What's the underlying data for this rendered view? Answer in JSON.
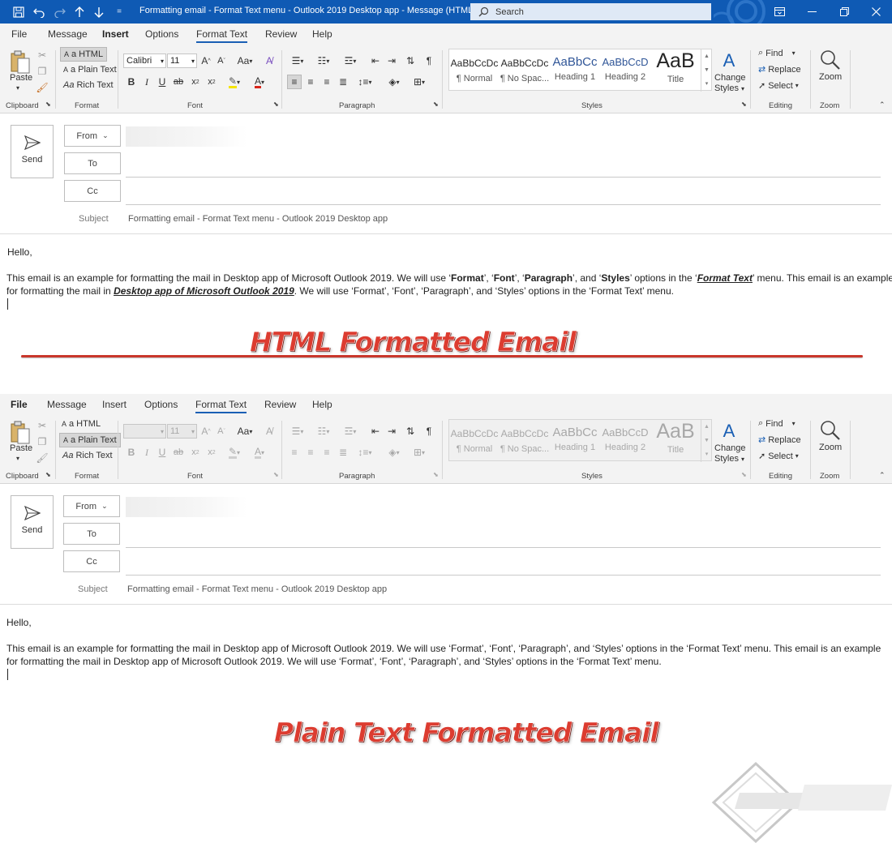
{
  "window": {
    "title": "Formatting email - Format Text menu - Outlook 2019 Desktop app  -  Message (HTML)",
    "search_placeholder": "Search",
    "qa_overflow": "="
  },
  "colors": {
    "titlebar": "#0f5ab4",
    "accent": "#1a5fb4",
    "banner_red": "#dc3c30"
  },
  "ribbon_top": {
    "tabs": [
      {
        "label": "File"
      },
      {
        "label": "Message"
      },
      {
        "label": "Insert"
      },
      {
        "label": "Options"
      },
      {
        "label": "Format Text"
      },
      {
        "label": "Review"
      },
      {
        "label": "Help"
      }
    ],
    "active_tab": "Format Text",
    "active_format": "HTML"
  },
  "ribbon_bottom": {
    "tabs": [
      {
        "label": "File"
      },
      {
        "label": "Message"
      },
      {
        "label": "Insert"
      },
      {
        "label": "Options"
      },
      {
        "label": "Format Text"
      },
      {
        "label": "Review"
      },
      {
        "label": "Help"
      }
    ],
    "active_tab": "Format Text",
    "active_format": "Plain Text"
  },
  "ribbon": {
    "paste": "Paste",
    "clipboard": "Clipboard",
    "format_group": "Format",
    "format_html": "HTML",
    "format_plain": "Plain Text",
    "format_rich": "Rich Text",
    "font_group": "Font",
    "font_name": "Calibri",
    "font_size": "11",
    "paragraph_group": "Paragraph",
    "styles_group": "Styles",
    "styles": [
      {
        "preview": "AaBbCcDc",
        "name": "¶ Normal"
      },
      {
        "preview": "AaBbCcDc",
        "name": "¶ No Spac..."
      },
      {
        "preview": "AaBbCc",
        "name": "Heading 1"
      },
      {
        "preview": "AaBbCcD",
        "name": "Heading 2"
      },
      {
        "preview": "AaB",
        "name": "Title"
      }
    ],
    "change_styles_1": "Change",
    "change_styles_2": "Styles",
    "find": "Find",
    "replace": "Replace",
    "select": "Select",
    "editing_group": "Editing",
    "zoom": "Zoom",
    "zoom_group": "Zoom"
  },
  "compose": {
    "send": "Send",
    "from": "From",
    "to": "To",
    "cc": "Cc",
    "subject_label": "Subject",
    "subject": "Formatting email - Format Text menu - Outlook 2019 Desktop app"
  },
  "html_email": {
    "greeting": "Hello,",
    "p1_a": "This email is an example for formatting the mail in Desktop app of Microsoft Outlook 2019. We will use  ‘",
    "p1_format": "Format",
    "p1_b": "’, ‘",
    "p1_font": "Font",
    "p1_c": "’, ‘",
    "p1_paragraph": "Paragraph",
    "p1_d": "’, and ‘",
    "p1_styles": "Styles",
    "p1_e": "’ options in the ‘",
    "p1_formattext": "Format Text",
    "p1_f": "’ menu. This email is an example",
    "p2_a": "for formatting the mail in ",
    "p2_link": "Desktop app of Microsoft Outlook 2019",
    "p2_b": ". We will use  ‘Format’, ‘Font’, ‘Paragraph’, and ‘Styles’ options in the ‘Format Text’ menu."
  },
  "plain_email": {
    "greeting": "Hello,",
    "line1": "This email is an example for formatting the mail in Desktop app of Microsoft Outlook 2019. We will use  ‘Format’, ‘Font’, ‘Paragraph’, and ‘Styles’ options in the ‘Format Text’ menu. This email is an example",
    "line2": "for formatting the mail in Desktop app of Microsoft Outlook 2019. We will use  ‘Format’, ‘Font’, ‘Paragraph’, and ‘Styles’ options in the ‘Format Text’ menu."
  },
  "banners": {
    "html": "HTML Formatted Email",
    "plain": "Plain Text Formatted Email"
  }
}
